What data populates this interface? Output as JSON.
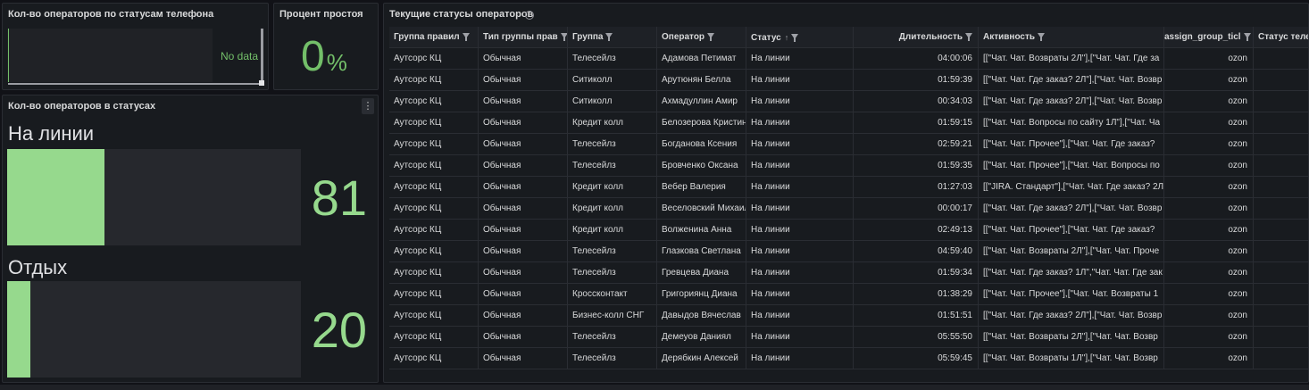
{
  "panels": {
    "phone_status": {
      "title": "Кол-во операторов по статусам телефона",
      "no_data": "No data",
      "accent": "#73bf69"
    },
    "idle_percent": {
      "title": "Процент простоя",
      "value": "0",
      "unit": "%",
      "accent": "#73bf69"
    },
    "operators_in_status": {
      "title": "Кол-во операторов в статусах",
      "menu_icon": "vertical-dots-icon",
      "gauges": [
        {
          "label": "На линии",
          "value": "81",
          "fill_fraction": 0.33
        },
        {
          "label": "Отдых",
          "value": "20",
          "fill_fraction": 0.08
        }
      ],
      "accent": "#96d98d"
    },
    "current_statuses": {
      "title": "Текущие статусы операторов",
      "info_icon": "info-icon",
      "columns": [
        "Группа правил",
        "Тип группы прав",
        "Группа",
        "Оператор",
        "Статус",
        "Длительность",
        "Активность",
        "assign_group_ticl",
        "Статус теле"
      ],
      "rows": [
        [
          "Аутсорс КЦ",
          "Обычная",
          "Телесейлз",
          "Адамова Петимат",
          "На линии",
          "04:00:06",
          "[[\"Чат. Чат. Возвраты 2Л\"],[\"Чат. Чат. Где за",
          "ozon",
          ""
        ],
        [
          "Аутсорс КЦ",
          "Обычная",
          "Ситиколл",
          "Арутюнян Белла",
          "На линии",
          "01:59:39",
          "[[\"Чат. Чат. Где заказ? 2Л\"],[\"Чат. Чат. Возвр",
          "ozon",
          ""
        ],
        [
          "Аутсорс КЦ",
          "Обычная",
          "Ситиколл",
          "Ахмадуллин Амир",
          "На линии",
          "00:34:03",
          "[[\"Чат. Чат. Где заказ? 2Л\"],[\"Чат. Чат. Возвр",
          "ozon",
          ""
        ],
        [
          "Аутсорс КЦ",
          "Обычная",
          "Кредит колл",
          "Белозерова Кристин",
          "На линии",
          "01:59:15",
          "[[\"Чат. Чат. Вопросы по сайту 1Л\"],[\"Чат. Ча",
          "ozon",
          ""
        ],
        [
          "Аутсорс КЦ",
          "Обычная",
          "Телесейлз",
          "Богданова Ксения",
          "На линии",
          "02:59:21",
          "[[\"Чат. Чат. Прочее\"],[\"Чат. Чат. Где заказ?",
          "ozon",
          ""
        ],
        [
          "Аутсорс КЦ",
          "Обычная",
          "Телесейлз",
          "Бровченко Оксана",
          "На линии",
          "01:59:35",
          "[[\"Чат. Чат. Прочее\"],[\"Чат. Чат. Вопросы по",
          "ozon",
          ""
        ],
        [
          "Аутсорс КЦ",
          "Обычная",
          "Кредит колл",
          "Вебер Валерия",
          "На линии",
          "01:27:03",
          "[[\"JIRA. Стандарт\"],[\"Чат. Чат. Где заказ? 2Л",
          "ozon",
          ""
        ],
        [
          "Аутсорс КЦ",
          "Обычная",
          "Кредит колл",
          "Веселовский Михаил",
          "На линии",
          "00:00:17",
          "[[\"Чат. Чат. Где заказ? 2Л\"],[\"Чат. Чат. Возвр",
          "ozon",
          ""
        ],
        [
          "Аутсорс КЦ",
          "Обычная",
          "Кредит колл",
          "Волженина Анна",
          "На линии",
          "02:49:13",
          "[[\"Чат. Чат. Прочее\"],[\"Чат. Чат. Где заказ?",
          "ozon",
          ""
        ],
        [
          "Аутсорс КЦ",
          "Обычная",
          "Телесейлз",
          "Глазкова Светлана",
          "На линии",
          "04:59:40",
          "[[\"Чат. Чат. Возвраты 2Л\"],[\"Чат. Чат. Проче",
          "ozon",
          ""
        ],
        [
          "Аутсорс КЦ",
          "Обычная",
          "Телесейлз",
          "Гревцева Диана",
          "На линии",
          "01:59:34",
          "[[\"Чат. Чат. Где заказ? 1Л\",\"Чат. Чат. Где зак",
          "ozon",
          ""
        ],
        [
          "Аутсорс КЦ",
          "Обычная",
          "Кроссконтакт",
          "Григориянц Диана",
          "На линии",
          "01:38:29",
          "[[\"Чат. Чат. Прочее\"],[\"Чат. Чат. Возвраты 1",
          "ozon",
          ""
        ],
        [
          "Аутсорс КЦ",
          "Обычная",
          "Бизнес-колл СНГ",
          "Давыдов Вячеслав",
          "На линии",
          "01:51:51",
          "[[\"Чат. Чат. Где заказ? 2Л\"],[\"Чат. Чат. Возвр",
          "ozon",
          ""
        ],
        [
          "Аутсорс КЦ",
          "Обычная",
          "Телесейлз",
          "Демеуов Даниял",
          "На линии",
          "05:55:50",
          "[[\"Чат. Чат. Возвраты 2Л\"],[\"Чат. Чат. Возвр",
          "ozon",
          ""
        ],
        [
          "Аутсорс КЦ",
          "Обычная",
          "Телесейлз",
          "Дерябкин Алексей",
          "На линии",
          "05:59:45",
          "[[\"Чат. Чат. Возвраты 1Л\"],[\"Чат. Чат. Возвр",
          "ozon",
          ""
        ]
      ]
    }
  }
}
